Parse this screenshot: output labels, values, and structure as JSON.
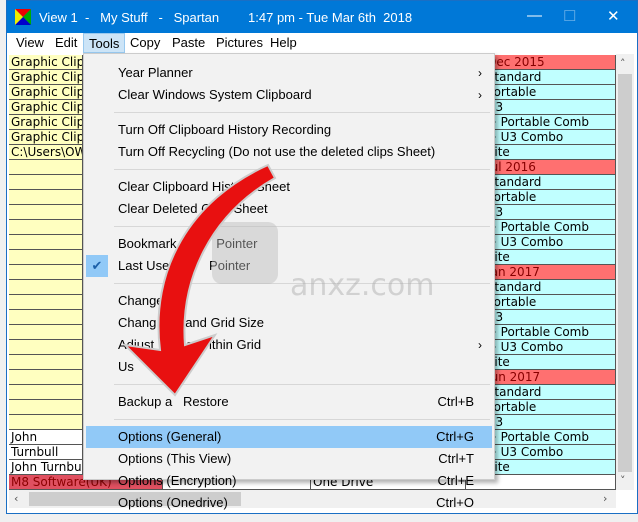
{
  "title": {
    "text": "View 1  -   My Stuff   -   Spartan        1:47 pm - Tue Mar 6th  2018",
    "minimize": "—",
    "maximize": "☐",
    "close": "✕"
  },
  "menubar": [
    "View",
    "Edit",
    "Tools",
    "Copy",
    "Paste",
    "Pictures",
    "Help"
  ],
  "menu": [
    {
      "label": "Year Planner",
      "sub": true
    },
    {
      "label": "Clear Windows System Clipboard",
      "sub": true
    },
    {
      "sep": true
    },
    {
      "label": "Turn Off Clipboard History Recording"
    },
    {
      "label": "Turn Off Recycling (Do not use the deleted clips Sheet)"
    },
    {
      "sep": true
    },
    {
      "label": "Clear Clipboard History Sheet"
    },
    {
      "label": "Clear Deleted Clips Sheet"
    },
    {
      "sep": true
    },
    {
      "label": "Bookmark Fi       Pointer"
    },
    {
      "label": "Last Used         Pointer",
      "checked": true
    },
    {
      "sep": true
    },
    {
      "label": "Change"
    },
    {
      "label": "Chang        and Grid Size"
    },
    {
      "label": "Adjust       ze Within Grid",
      "sub": true
    },
    {
      "label": "Us"
    },
    {
      "sep": true
    },
    {
      "label": "Backup a   Restore",
      "shortcut": "Ctrl+B"
    },
    {
      "sep": true
    },
    {
      "label": "Options (General)",
      "shortcut": "Ctrl+G",
      "highlighted": true
    },
    {
      "label": "Options (This View)",
      "shortcut": "Ctrl+T"
    },
    {
      "label": "Options (Encryption)",
      "shortcut": "Ctrl+E"
    },
    {
      "label": "Options (Onedrive)",
      "shortcut": "Ctrl+O"
    }
  ],
  "grid": {
    "col1": [
      "Graphic Clip",
      "Graphic Clip",
      "Graphic Clip",
      "Graphic Clip",
      "Graphic Clip",
      "Graphic Clip",
      "C:\\Users\\OW",
      "",
      "",
      "",
      "",
      "",
      "",
      "",
      "",
      "",
      "",
      "",
      "",
      "",
      "",
      "",
      "",
      "",
      "",
      "John",
      "Turnbull",
      "John Turnbul",
      "M8 Software(UK)"
    ],
    "col3_last": "One Drive",
    "col4": [
      "15 Dec 2015",
      "an Standard",
      "an Portable",
      "an U3",
      "an + Portable Comb",
      "an + U3 Combo",
      "an Site",
      "26 Jul 2016",
      "an Standard",
      "an Portable",
      "an U3",
      "an + Portable Comb",
      "an + U3 Combo",
      "an Site",
      "16 Jan 2017",
      "an Standard",
      "an Portable",
      "an U3",
      "an + Portable Comb",
      "an + U3 Combo",
      "an Site",
      "30 Jun 2017",
      "an Standard",
      "an Portable",
      "an U3",
      "an + Portable Comb",
      "an + U3 Combo",
      "an Site",
      ""
    ]
  },
  "watermark": "anxz.com",
  "colors": {
    "titlebar": "#0078d7",
    "yellow": "#ffffc0",
    "cyan": "#c0ffff",
    "date_red": "#ff7070",
    "m8_red": "#e05060",
    "highlight": "#91c9f7"
  }
}
